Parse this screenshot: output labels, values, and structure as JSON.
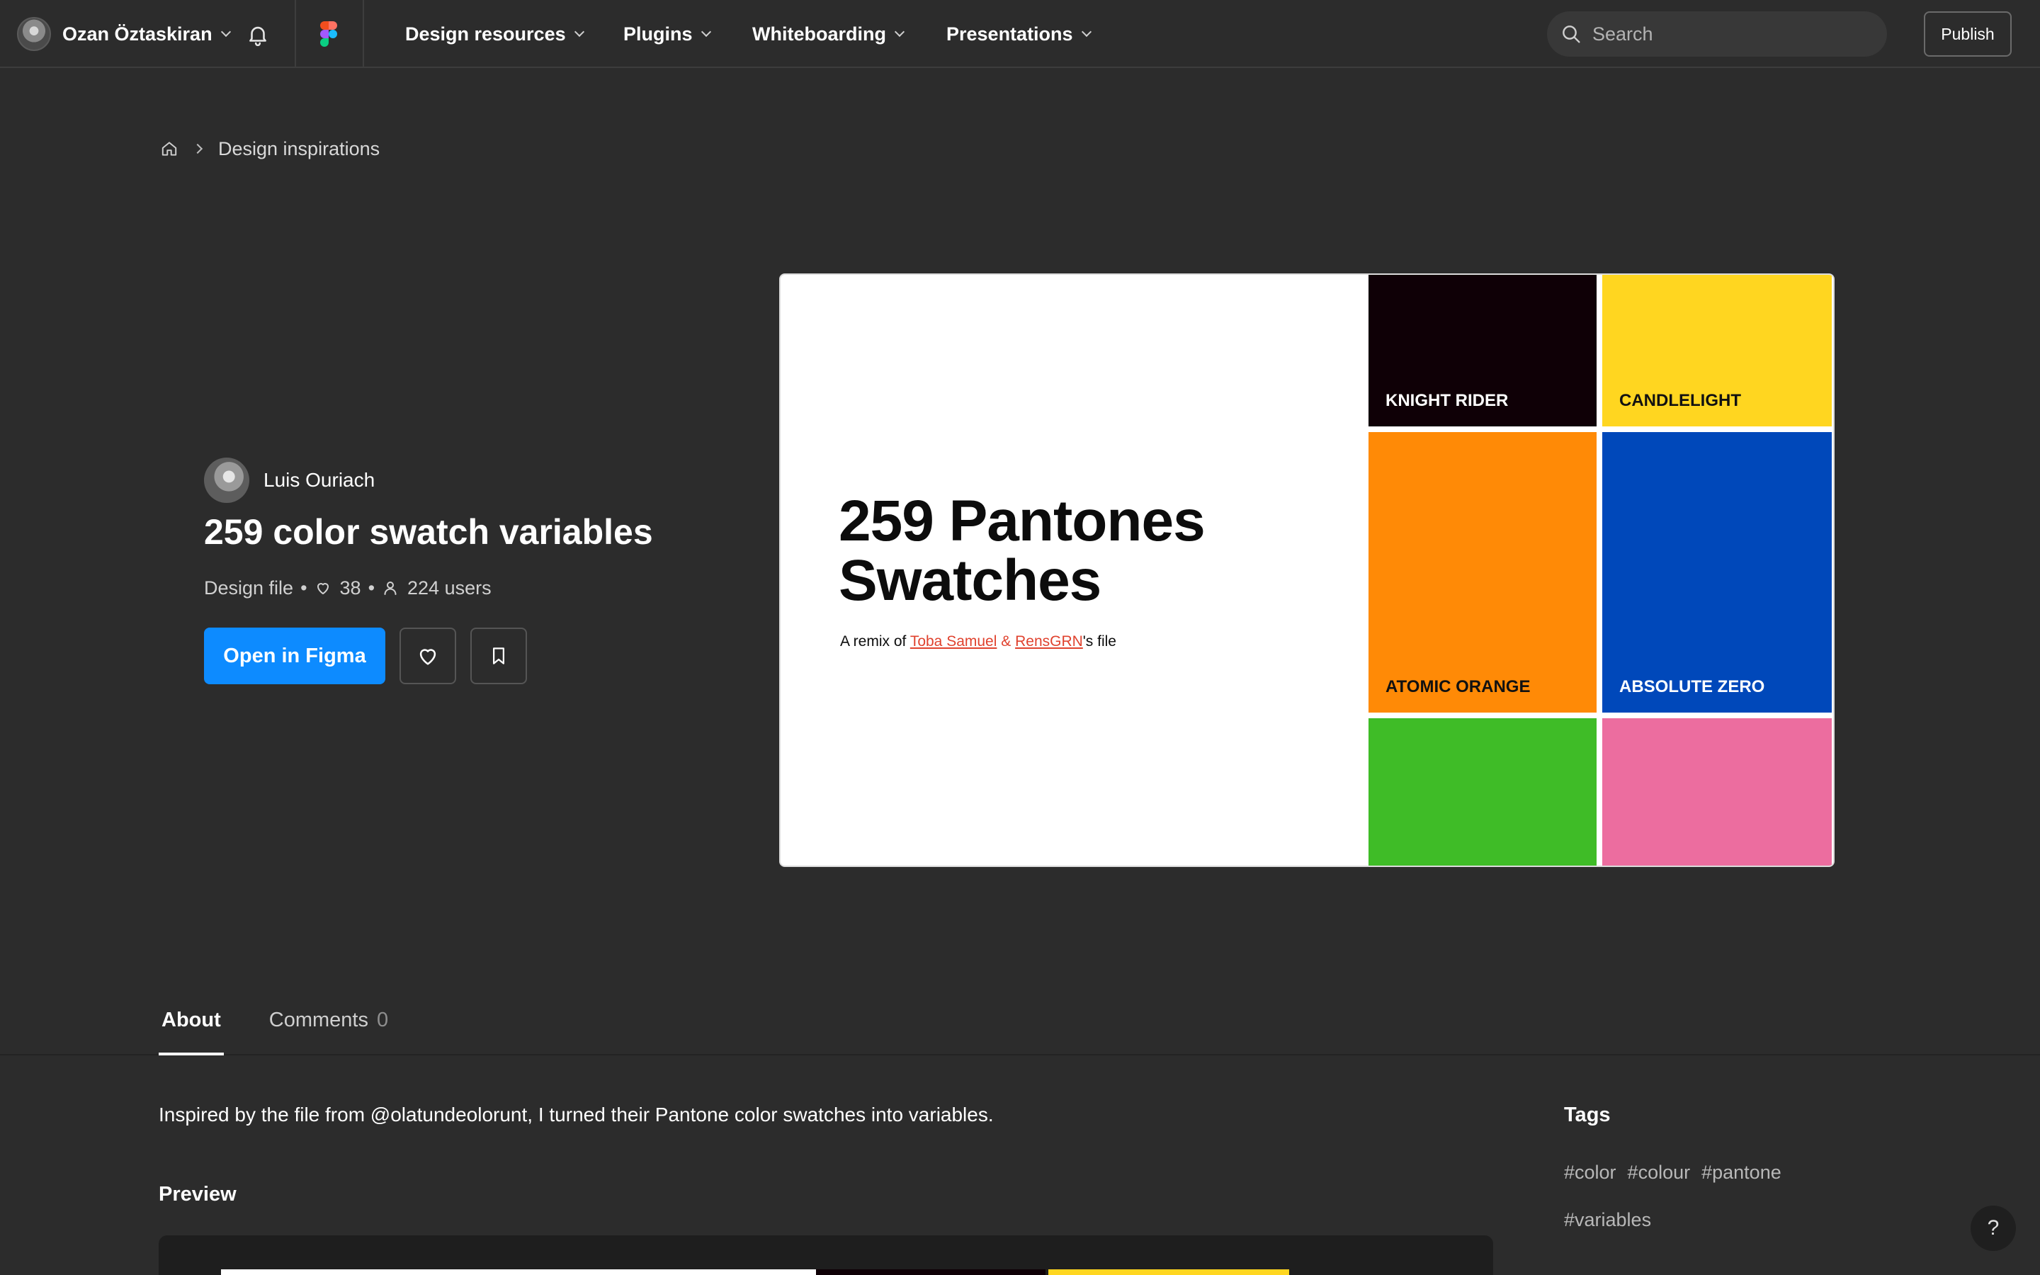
{
  "topnav": {
    "user_name": "Ozan Öztaskiran",
    "menu": [
      {
        "label": "Design resources"
      },
      {
        "label": "Plugins"
      },
      {
        "label": "Whiteboarding"
      },
      {
        "label": "Presentations"
      }
    ],
    "search_placeholder": "Search",
    "publish_label": "Publish"
  },
  "breadcrumb": {
    "home_icon": "home-icon",
    "current": "Design inspirations"
  },
  "file": {
    "author": "Luis Ouriach",
    "title": "259 color swatch variables",
    "type": "Design file",
    "likes": "38",
    "users": "224 users",
    "open_label": "Open in Figma",
    "like_icon": "heart-icon",
    "bookmark_icon": "bookmark-icon"
  },
  "thumbnail": {
    "title_line1": "259 Pantones",
    "title_line2": "Swatches",
    "remix_prefix": "A remix of ",
    "author1": "Toba Samuel",
    "amp": " & ",
    "author2": "RensGRN",
    "remix_suffix": "'s file",
    "swatches": [
      {
        "name": "KNIGHT RIDER",
        "color": "#0f0006",
        "text_color": "#ffffff"
      },
      {
        "name": "CANDLELIGHT",
        "color": "#ffd620",
        "text_color": "#111111"
      },
      {
        "name": "ATOMIC ORANGE",
        "color": "#ff8a06",
        "text_color": "#111111"
      },
      {
        "name": "ABSOLUTE ZERO",
        "color": "#0048ba",
        "text_color": "#ffffff"
      },
      {
        "name": "",
        "color": "#3fbc27",
        "text_color": "#111111"
      },
      {
        "name": "",
        "color": "#ec6d9f",
        "text_color": "#111111"
      }
    ]
  },
  "tabs": {
    "about": "About",
    "comments": "Comments",
    "comments_count": "0"
  },
  "about": {
    "description": "Inspired by the file from @olatundeolorunt, I turned their Pantone color swatches into variables.",
    "preview_heading": "Preview"
  },
  "tags": {
    "heading": "Tags",
    "items": [
      "#color",
      "#colour",
      "#pantone",
      "#variables"
    ]
  },
  "help_label": "?",
  "colors": {
    "background": "#2c2c2c",
    "accent": "#0d8bff",
    "link": "#e0422e"
  }
}
